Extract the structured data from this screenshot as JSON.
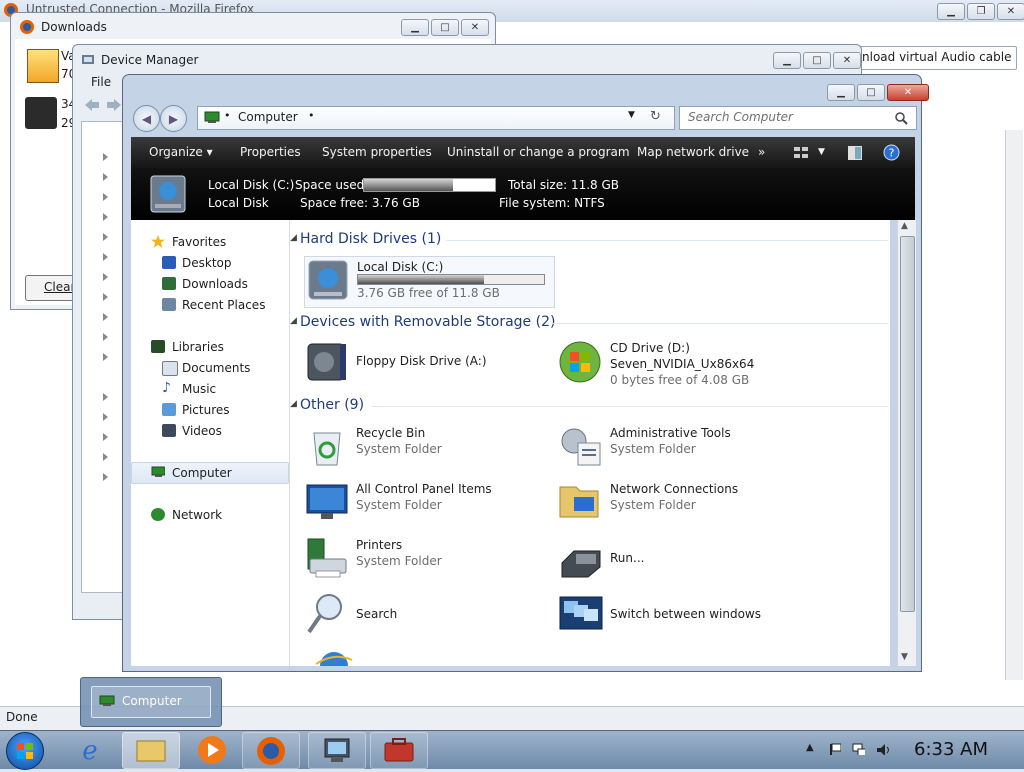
{
  "firefox": {
    "title": "Untrusted Connection - Mozilla Firefox",
    "search_text": "nload virtual Audio cable",
    "status": "Done"
  },
  "downloads": {
    "title": "Downloads",
    "item1_name": "Va",
    "item1_info": "70",
    "item2_name": "34",
    "item2_info": "29",
    "clear_label": "Clear"
  },
  "device_manager": {
    "title": "Device Manager",
    "menu_file": "File"
  },
  "explorer": {
    "address": "Computer",
    "search_placeholder": "Search Computer",
    "toolbar": {
      "organize": "Organize",
      "properties": "Properties",
      "system_properties": "System properties",
      "uninstall": "Uninstall or change a program",
      "map_drive": "Map network drive",
      "more": "»"
    },
    "details": {
      "name": "Local Disk (C:)",
      "type": "Local Disk",
      "space_used_label": "Space used:",
      "space_free": "Space free: 3.76 GB",
      "total_size": "Total size: 11.8 GB",
      "file_system": "File system: NTFS",
      "used_fraction": 0.68
    },
    "nav": {
      "favorites": "Favorites",
      "desktop": "Desktop",
      "downloads": "Downloads",
      "recent_places": "Recent Places",
      "libraries": "Libraries",
      "documents": "Documents",
      "music": "Music",
      "pictures": "Pictures",
      "videos": "Videos",
      "computer": "Computer",
      "network": "Network"
    },
    "groups": {
      "hard_disk": "Hard Disk Drives (1)",
      "removable": "Devices with Removable Storage (2)",
      "other": "Other (9)"
    },
    "items": {
      "local_disk": {
        "name": "Local Disk (C:)",
        "info": "3.76 GB free of 11.8 GB",
        "used_fraction": 0.68
      },
      "floppy": {
        "name": "Floppy Disk Drive (A:)"
      },
      "cd": {
        "name": "CD Drive (D:)",
        "label": "Seven_NVIDIA_Ux86x64",
        "info": "0 bytes free of 4.08 GB"
      },
      "recycle": {
        "name": "Recycle Bin",
        "type": "System Folder"
      },
      "admin_tools": {
        "name": "Administrative Tools",
        "type": "System Folder"
      },
      "control_panel": {
        "name": "All Control Panel Items",
        "type": "System Folder"
      },
      "network_conn": {
        "name": "Network Connections",
        "type": "System Folder"
      },
      "printers": {
        "name": "Printers",
        "type": "System Folder"
      },
      "run": {
        "name": "Run..."
      },
      "search": {
        "name": "Search"
      },
      "switch_windows": {
        "name": "Switch between windows"
      }
    }
  },
  "taskbar": {
    "preview_label": "Computer",
    "clock": "6:33 AM"
  }
}
